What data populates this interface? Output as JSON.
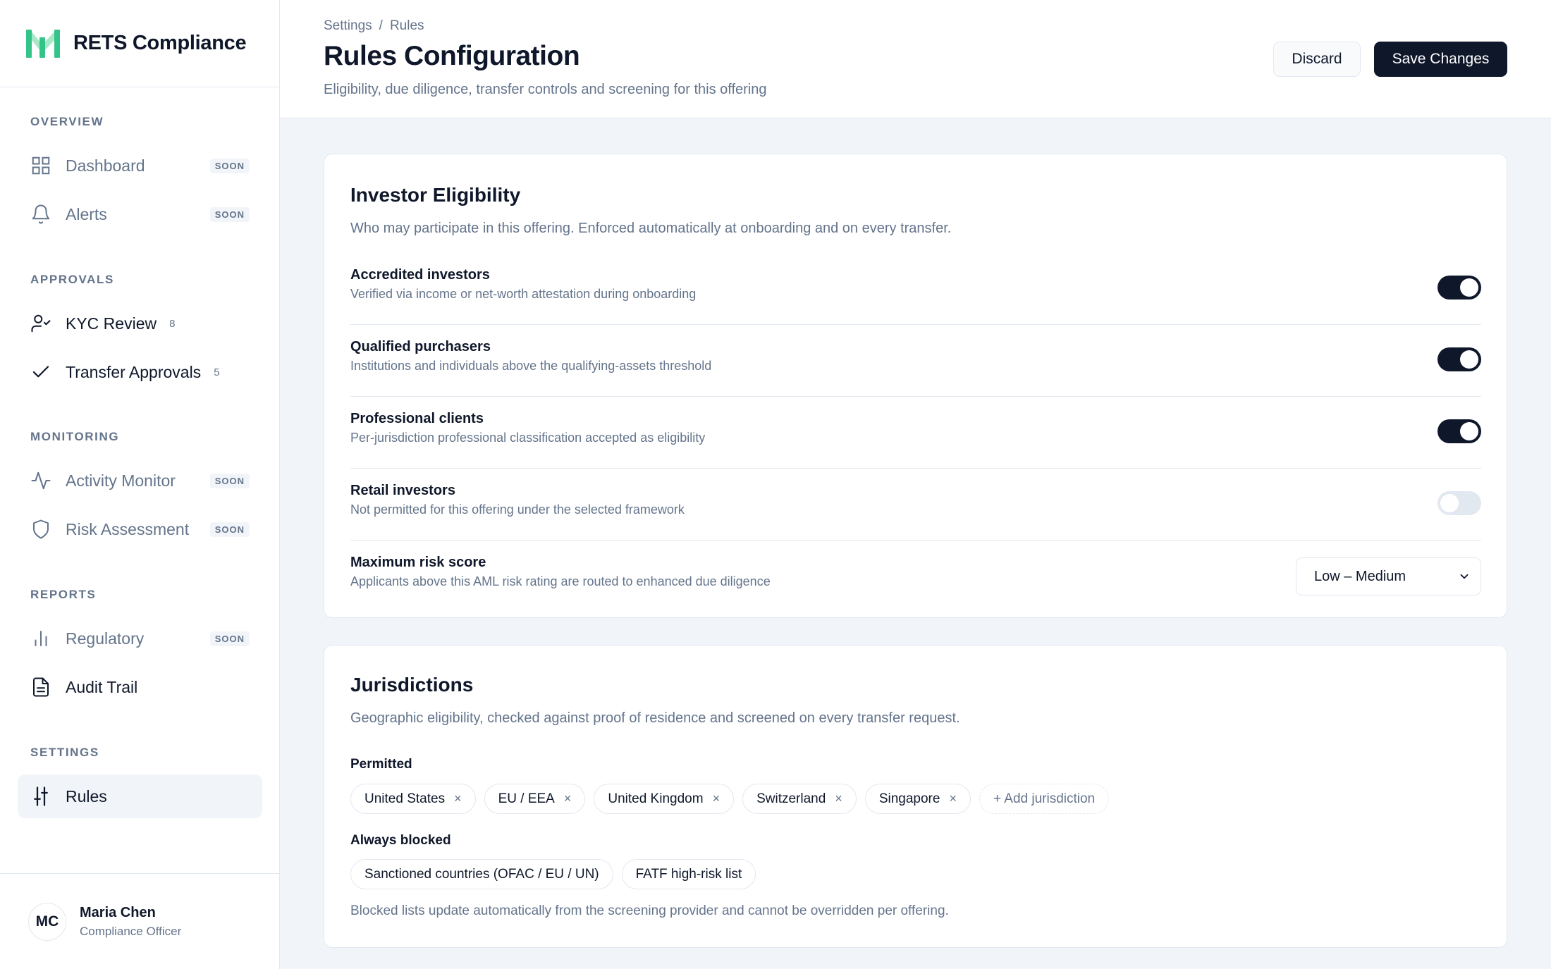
{
  "brand": {
    "name": "RETS Compliance"
  },
  "colors": {
    "accent": "#0f172a",
    "brand_green": "#34c48a",
    "muted": "#64748b"
  },
  "sidebar": {
    "sections": [
      {
        "label": "OVERVIEW"
      },
      {
        "label": "APPROVALS"
      },
      {
        "label": "MONITORING"
      },
      {
        "label": "REPORTS"
      },
      {
        "label": "SETTINGS"
      }
    ],
    "items": [
      {
        "label": "Dashboard",
        "icon": "grid-icon",
        "badge": "SOON"
      },
      {
        "label": "Alerts",
        "icon": "bell-icon",
        "badge": "SOON"
      },
      {
        "label": "KYC Review",
        "icon": "user-check-icon",
        "count": "8"
      },
      {
        "label": "Transfer Approvals",
        "icon": "check-icon",
        "count": "5"
      },
      {
        "label": "Activity Monitor",
        "icon": "activity-icon",
        "badge": "SOON"
      },
      {
        "label": "Risk Assessment",
        "icon": "shield-icon",
        "badge": "SOON"
      },
      {
        "label": "Regulatory",
        "icon": "bar-chart-icon",
        "badge": "SOON"
      },
      {
        "label": "Audit Trail",
        "icon": "file-text-icon"
      },
      {
        "label": "Rules",
        "icon": "sliders-icon"
      }
    ]
  },
  "user": {
    "initials": "MC",
    "name": "Maria Chen",
    "role": "Compliance Officer"
  },
  "header": {
    "breadcrumb": [
      "Settings",
      "/",
      "Rules"
    ],
    "title": "Rules Configuration",
    "subtitle": "Eligibility, due diligence, transfer controls and screening for this offering",
    "discard_label": "Discard",
    "save_label": "Save Changes"
  },
  "eligibility": {
    "title": "Investor Eligibility",
    "description": "Who may participate in this offering. Enforced automatically at onboarding and on every transfer.",
    "rows": [
      {
        "title": "Accredited investors",
        "desc": "Verified via income or net-worth attestation during onboarding",
        "enabled": true
      },
      {
        "title": "Qualified purchasers",
        "desc": "Institutions and individuals above the qualifying-assets threshold",
        "enabled": true
      },
      {
        "title": "Professional clients",
        "desc": "Per-jurisdiction professional classification accepted as eligibility",
        "enabled": true
      },
      {
        "title": "Retail investors",
        "desc": "Not permitted for this offering under the selected framework",
        "enabled": false
      }
    ],
    "risk": {
      "title": "Maximum risk score",
      "desc": "Applicants above this AML risk rating are routed to enhanced due diligence",
      "value": "Low – Medium"
    }
  },
  "jurisdictions": {
    "title": "Jurisdictions",
    "description": "Geographic eligibility, checked against proof of residence and screened on every transfer request.",
    "permitted_label": "Permitted",
    "permitted": [
      "United States",
      "EU / EEA",
      "United Kingdom",
      "Switzerland",
      "Singapore"
    ],
    "add_label": "+ Add jurisdiction",
    "remove_glyph": "×",
    "blocked_label": "Always blocked",
    "blocked": [
      "Sanctioned countries (OFAC / EU / UN)",
      "FATF high-risk list"
    ],
    "note": "Blocked lists update automatically from the screening provider and cannot be overridden per offering."
  }
}
